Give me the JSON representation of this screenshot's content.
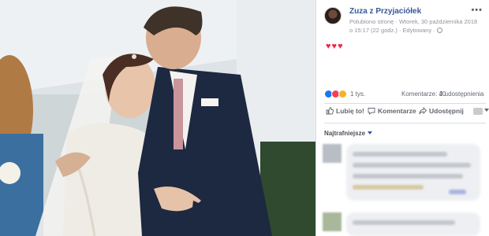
{
  "post": {
    "page_name": "Zuza z Przyjaciółek",
    "meta_line1": "Polubiono stronę · Wtorek, 30 października 2018",
    "meta_line2": "o 15:17 (22 godz.) · Edytowany ·",
    "more_label": "•••",
    "caption_hearts": "♥♥♥"
  },
  "stats": {
    "reactions_count": "1 tys.",
    "comments": "Komentarze: 40",
    "shares": "2 udostępnienia"
  },
  "actions": {
    "like_label": "Lubię to!",
    "comment_label": "Komentarze",
    "share_label": "Udostępnij"
  },
  "comments_section": {
    "sort_label": "Najtrafniejsze"
  },
  "colors": {
    "link_blue": "#385898",
    "heart_red": "#f02849",
    "like_blue": "#1877f2"
  },
  "icons": [
    "globe-icon",
    "like-icon",
    "comment-icon",
    "share-icon",
    "more-icon"
  ]
}
